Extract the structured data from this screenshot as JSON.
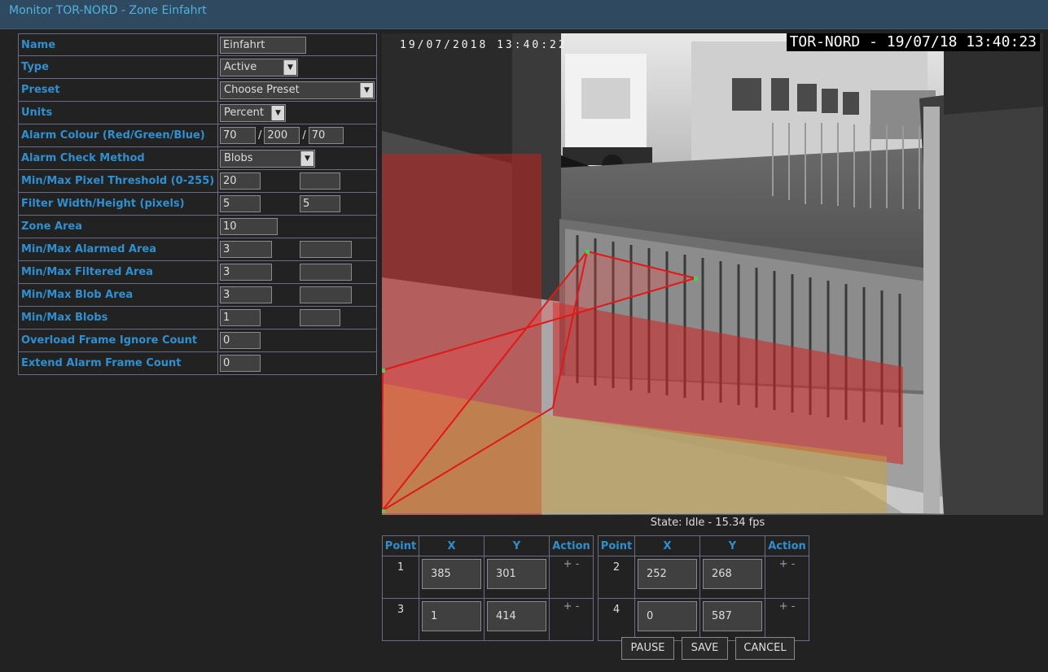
{
  "window": {
    "title": "Monitor TOR-NORD - Zone Einfahrt"
  },
  "settings": {
    "name": {
      "label": "Name",
      "value": "Einfahrt"
    },
    "type": {
      "label": "Type",
      "value": "Active"
    },
    "preset": {
      "label": "Preset",
      "value": "Choose Preset"
    },
    "units": {
      "label": "Units",
      "value": "Percent"
    },
    "alarm_colour": {
      "label": "Alarm Colour (Red/Green/Blue)",
      "red": "70",
      "green": "200",
      "blue": "70",
      "sep": "/"
    },
    "alarm_check_method": {
      "label": "Alarm Check Method",
      "value": "Blobs"
    },
    "pixel_threshold": {
      "label": "Min/Max Pixel Threshold (0-255)",
      "min": "20",
      "max": ""
    },
    "filter_size": {
      "label": "Filter Width/Height (pixels)",
      "width": "5",
      "height": "5"
    },
    "zone_area": {
      "label": "Zone Area",
      "value": "10"
    },
    "alarmed_area": {
      "label": "Min/Max Alarmed Area",
      "min": "3",
      "max": ""
    },
    "filtered_area": {
      "label": "Min/Max Filtered Area",
      "min": "3",
      "max": ""
    },
    "blob_area": {
      "label": "Min/Max Blob Area",
      "min": "3",
      "max": ""
    },
    "blobs": {
      "label": "Min/Max Blobs",
      "min": "1",
      "max": ""
    },
    "overload_ignore": {
      "label": "Overload Frame Ignore Count",
      "value": "0"
    },
    "extend_alarm": {
      "label": "Extend Alarm Frame Count",
      "value": "0"
    }
  },
  "camera": {
    "osd_left": "19/07/2018 13:40:22",
    "osd_right": "TOR-NORD - 19/07/18 13:40:23"
  },
  "state": "State: Idle - 15.34 fps",
  "points": {
    "headers": {
      "point": "Point",
      "x": "X",
      "y": "Y",
      "action": "Action"
    },
    "action_text": "+ -",
    "list": [
      {
        "n": "1",
        "x": "385",
        "y": "301"
      },
      {
        "n": "2",
        "x": "252",
        "y": "268"
      },
      {
        "n": "3",
        "x": "1",
        "y": "414"
      },
      {
        "n": "4",
        "x": "0",
        "y": "587"
      }
    ]
  },
  "buttons": {
    "pause": "PAUSE",
    "save": "SAVE",
    "cancel": "CANCEL"
  },
  "colors": {
    "zone_outline": "#e01818",
    "accent": "#2f8fcf",
    "title": "#4fb3e0"
  }
}
